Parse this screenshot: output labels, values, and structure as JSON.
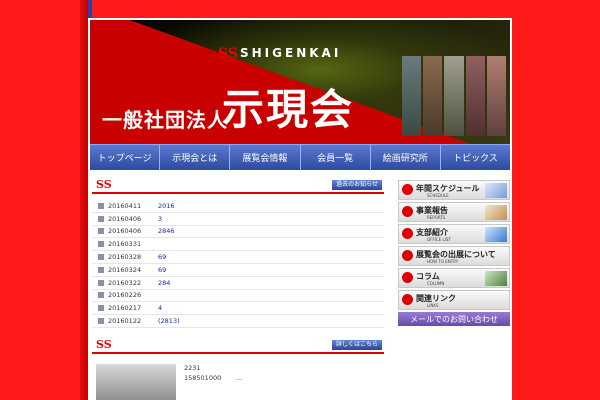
{
  "header": {
    "logo_mark": "SS",
    "logo_text": "SHIGENKAI",
    "title_small": "一般社団法人",
    "title_big": "示現会"
  },
  "nav": [
    "トップページ",
    "示現会とは",
    "展覧会情報",
    "会員一覧",
    "絵画研究所",
    "トピックス"
  ],
  "news_section": {
    "mark": "SS",
    "button": "過去のお知らせ",
    "rows": [
      {
        "date": "20160411",
        "title": "2016"
      },
      {
        "date": "20160406",
        "title": "3"
      },
      {
        "date": "20160406",
        "title": "2846"
      },
      {
        "date": "20160331",
        "title": ""
      },
      {
        "date": "20160328",
        "title": "69"
      },
      {
        "date": "20160324",
        "title": "69"
      },
      {
        "date": "20160322",
        "title": "284"
      },
      {
        "date": "20160226",
        "title": ""
      },
      {
        "date": "20160217",
        "title": "4"
      },
      {
        "date": "20160122",
        "title": "(2813)"
      }
    ]
  },
  "topic_section": {
    "mark": "SS",
    "button": "詳しくはこちら",
    "line1": "2231",
    "line2": "158501000",
    "ellipsis": "..."
  },
  "sidebar": {
    "items": [
      {
        "label": "年間スケジュール",
        "sub": "SCHEDULE"
      },
      {
        "label": "事業報告",
        "sub": "REPORTS"
      },
      {
        "label": "支部紹介",
        "sub": "OFFICE LIST"
      },
      {
        "label": "展覧会の出展について",
        "sub": "HOW TO ENTRY"
      },
      {
        "label": "コラム",
        "sub": "COLUMN"
      },
      {
        "label": "関連リンク",
        "sub": "LINKS"
      }
    ],
    "mail": "メールでのお問い合わせ"
  },
  "colors": {
    "background": "#ff1a1a",
    "nav": "#2c4aa0",
    "accent": "#dd0000",
    "mail": "#7a5ab8"
  }
}
